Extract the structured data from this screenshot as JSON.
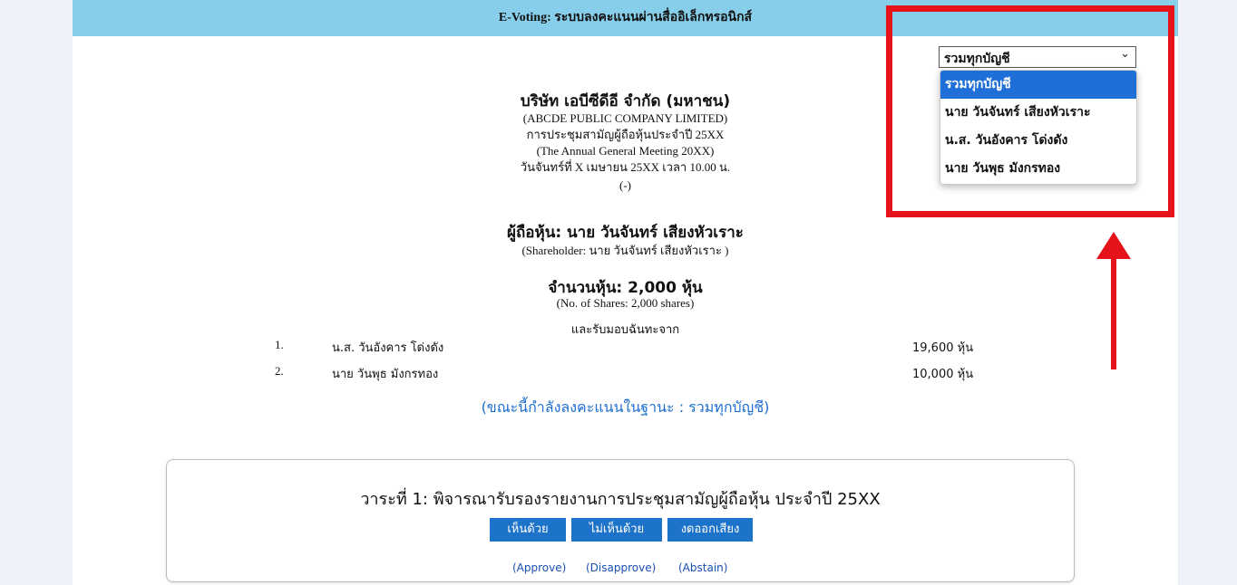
{
  "header": {
    "title": "E-Voting: ระบบลงคะแนนผ่านสื่ออิเล็กทรอนิกส์"
  },
  "company": {
    "name_th": "บริษัท เอบีซีดีอี จำกัด (มหาชน)",
    "name_en": "(ABCDE PUBLIC COMPANY LIMITED)",
    "meeting_th": "การประชุมสามัญผู้ถือหุ้นประจำปี 25XX",
    "meeting_en": "(The Annual General Meeting 20XX)",
    "meeting_date": "วันจันทร์ที่ X เมษายน 25XX เวลา 10.00 น.",
    "meeting_note": "(-)"
  },
  "shareholder": {
    "label_th": "ผู้ถือหุ้น: นาย วันจันทร์ เสียงหัวเราะ",
    "label_en": "(Shareholder: นาย วันจันทร์ เสียงหัวเราะ )",
    "shares_th": "จำนวนหุ้น: 2,000 หุ้น",
    "shares_en": "(No. of Shares: 2,000 shares)"
  },
  "proxies": {
    "heading": "และรับมอบฉันทะจาก",
    "rows": [
      {
        "num": "1.",
        "name": "น.ส. วันอังคาร โด่งดัง",
        "shares": "19,600 หุ้น"
      },
      {
        "num": "2.",
        "name": "นาย วันพุธ มังกรทอง",
        "shares": "10,000 หุ้น"
      }
    ]
  },
  "voting_status": "(ขณะนี้กำลังลงคะแนนในฐานะ : รวมทุกบัญชี)",
  "agenda": {
    "title": "วาระที่ 1: พิจารณารับรองรายงานการประชุมสามัญผู้ถือหุ้น ประจำปี 25XX",
    "buttons": {
      "approve": "เห็นด้วย",
      "disapprove": "ไม่เห็นด้วย",
      "abstain": "งดออกเสียง"
    },
    "labels": {
      "approve": "(Approve)",
      "disapprove": "(Disapprove)",
      "abstain": "(Abstain)"
    }
  },
  "account_select": {
    "value": "รวมทุกบัญชี",
    "arrow": "⌄",
    "options": [
      "รวมทุกบัญชี",
      "นาย วันจันทร์ เสียงหัวเราะ",
      "น.ส. วันอังคาร โด่งดัง",
      "นาย วันพุธ มังกรทอง"
    ],
    "selected_index": 0
  },
  "colors": {
    "topbar": "#87ceeb",
    "accent_blue": "#1d72c9",
    "annotation_red": "#e6131b"
  }
}
